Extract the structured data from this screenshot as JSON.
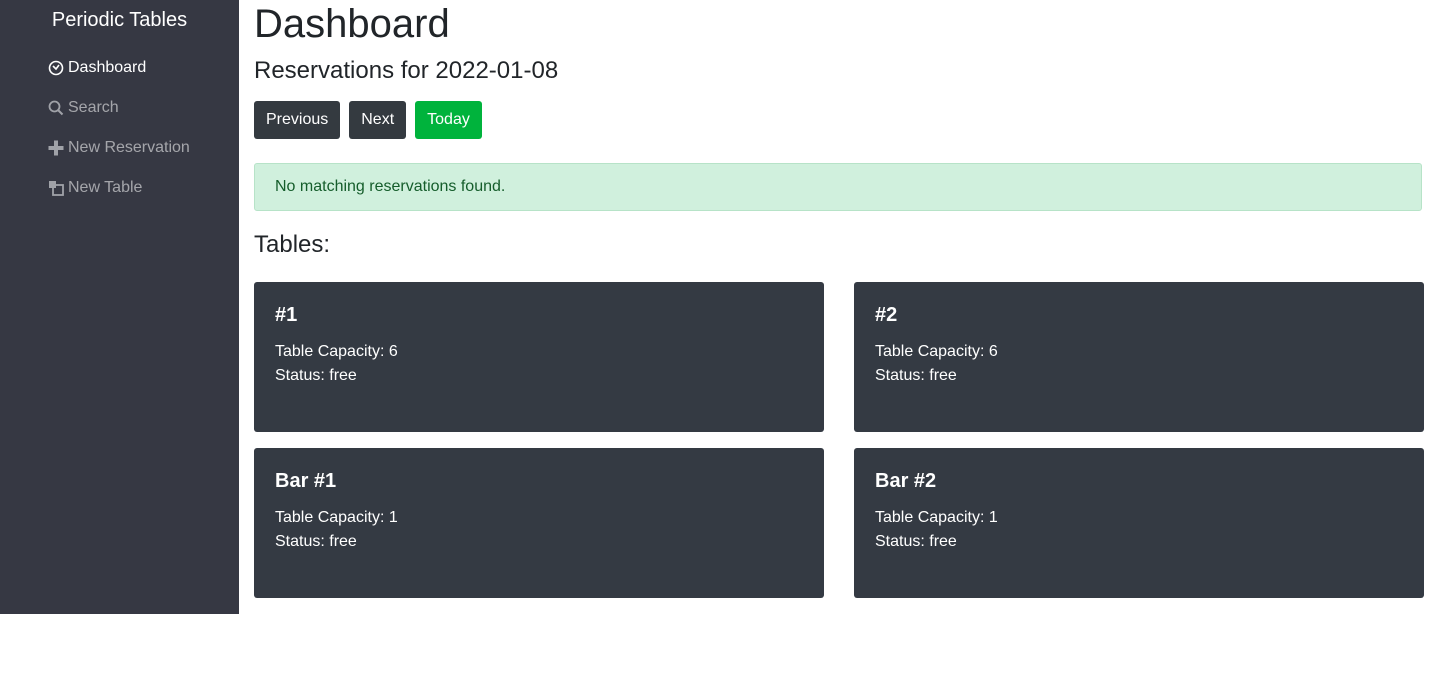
{
  "sidebar": {
    "brand": "Periodic Tables",
    "items": [
      {
        "label": "Dashboard",
        "icon": "dashboard-icon",
        "active": true
      },
      {
        "label": "Search",
        "icon": "search-icon",
        "active": false
      },
      {
        "label": "New Reservation",
        "icon": "plus-icon",
        "active": false
      },
      {
        "label": "New Table",
        "icon": "table-icon",
        "active": false
      }
    ]
  },
  "main": {
    "title": "Dashboard",
    "subtitle": "Reservations for 2022-01-08",
    "buttons": {
      "previous": "Previous",
      "next": "Next",
      "today": "Today"
    },
    "alert": "No matching reservations found.",
    "tables_heading": "Tables:",
    "tables": [
      {
        "name": "#1",
        "capacity_line": "Table Capacity: 6",
        "status_line": "Status: free"
      },
      {
        "name": "#2",
        "capacity_line": "Table Capacity: 6",
        "status_line": "Status: free"
      },
      {
        "name": "Bar #1",
        "capacity_line": "Table Capacity: 1",
        "status_line": "Status: free"
      },
      {
        "name": "Bar #2",
        "capacity_line": "Table Capacity: 1",
        "status_line": "Status: free"
      }
    ]
  },
  "colors": {
    "sidebar_bg": "#363843",
    "card_bg": "#343a43",
    "button_dark": "#343a40",
    "button_success": "#00b33c",
    "alert_bg": "#d0f0dd",
    "alert_text": "#155d2b"
  }
}
